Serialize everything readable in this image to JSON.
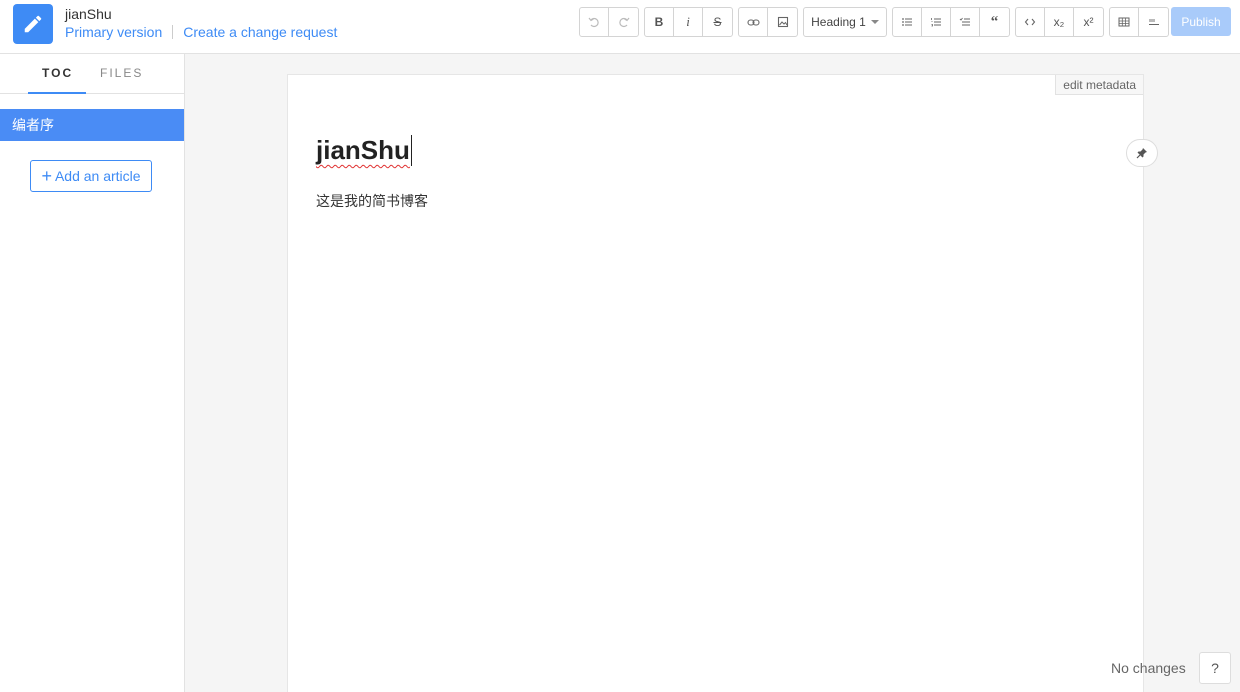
{
  "header": {
    "book_title": "jianShu",
    "primary_version_label": "Primary version",
    "change_request_label": "Create a change request"
  },
  "toolbar": {
    "undo_icon": "undo-icon",
    "redo_icon": "redo-icon",
    "bold_label": "B",
    "italic_label": "i",
    "strike_label": "S",
    "heading_label": "Heading 1",
    "subscript_label": "x₂",
    "superscript_label": "x²",
    "publish_label": "Publish"
  },
  "sidebar": {
    "tabs": [
      {
        "label": "TOC"
      },
      {
        "label": "FILES"
      }
    ],
    "toc_items": [
      {
        "label": "编者序"
      }
    ],
    "add_article_label": "Add an article"
  },
  "editor": {
    "edit_metadata_label": "edit metadata",
    "title": "jianShu",
    "body_text": "这是我的简书博客"
  },
  "footer": {
    "status": "No changes",
    "help_label": "?"
  },
  "colors": {
    "accent": "#3e8bf5",
    "toc_active_bg": "#4a8cf5",
    "publish_disabled": "#a9cbfa"
  }
}
